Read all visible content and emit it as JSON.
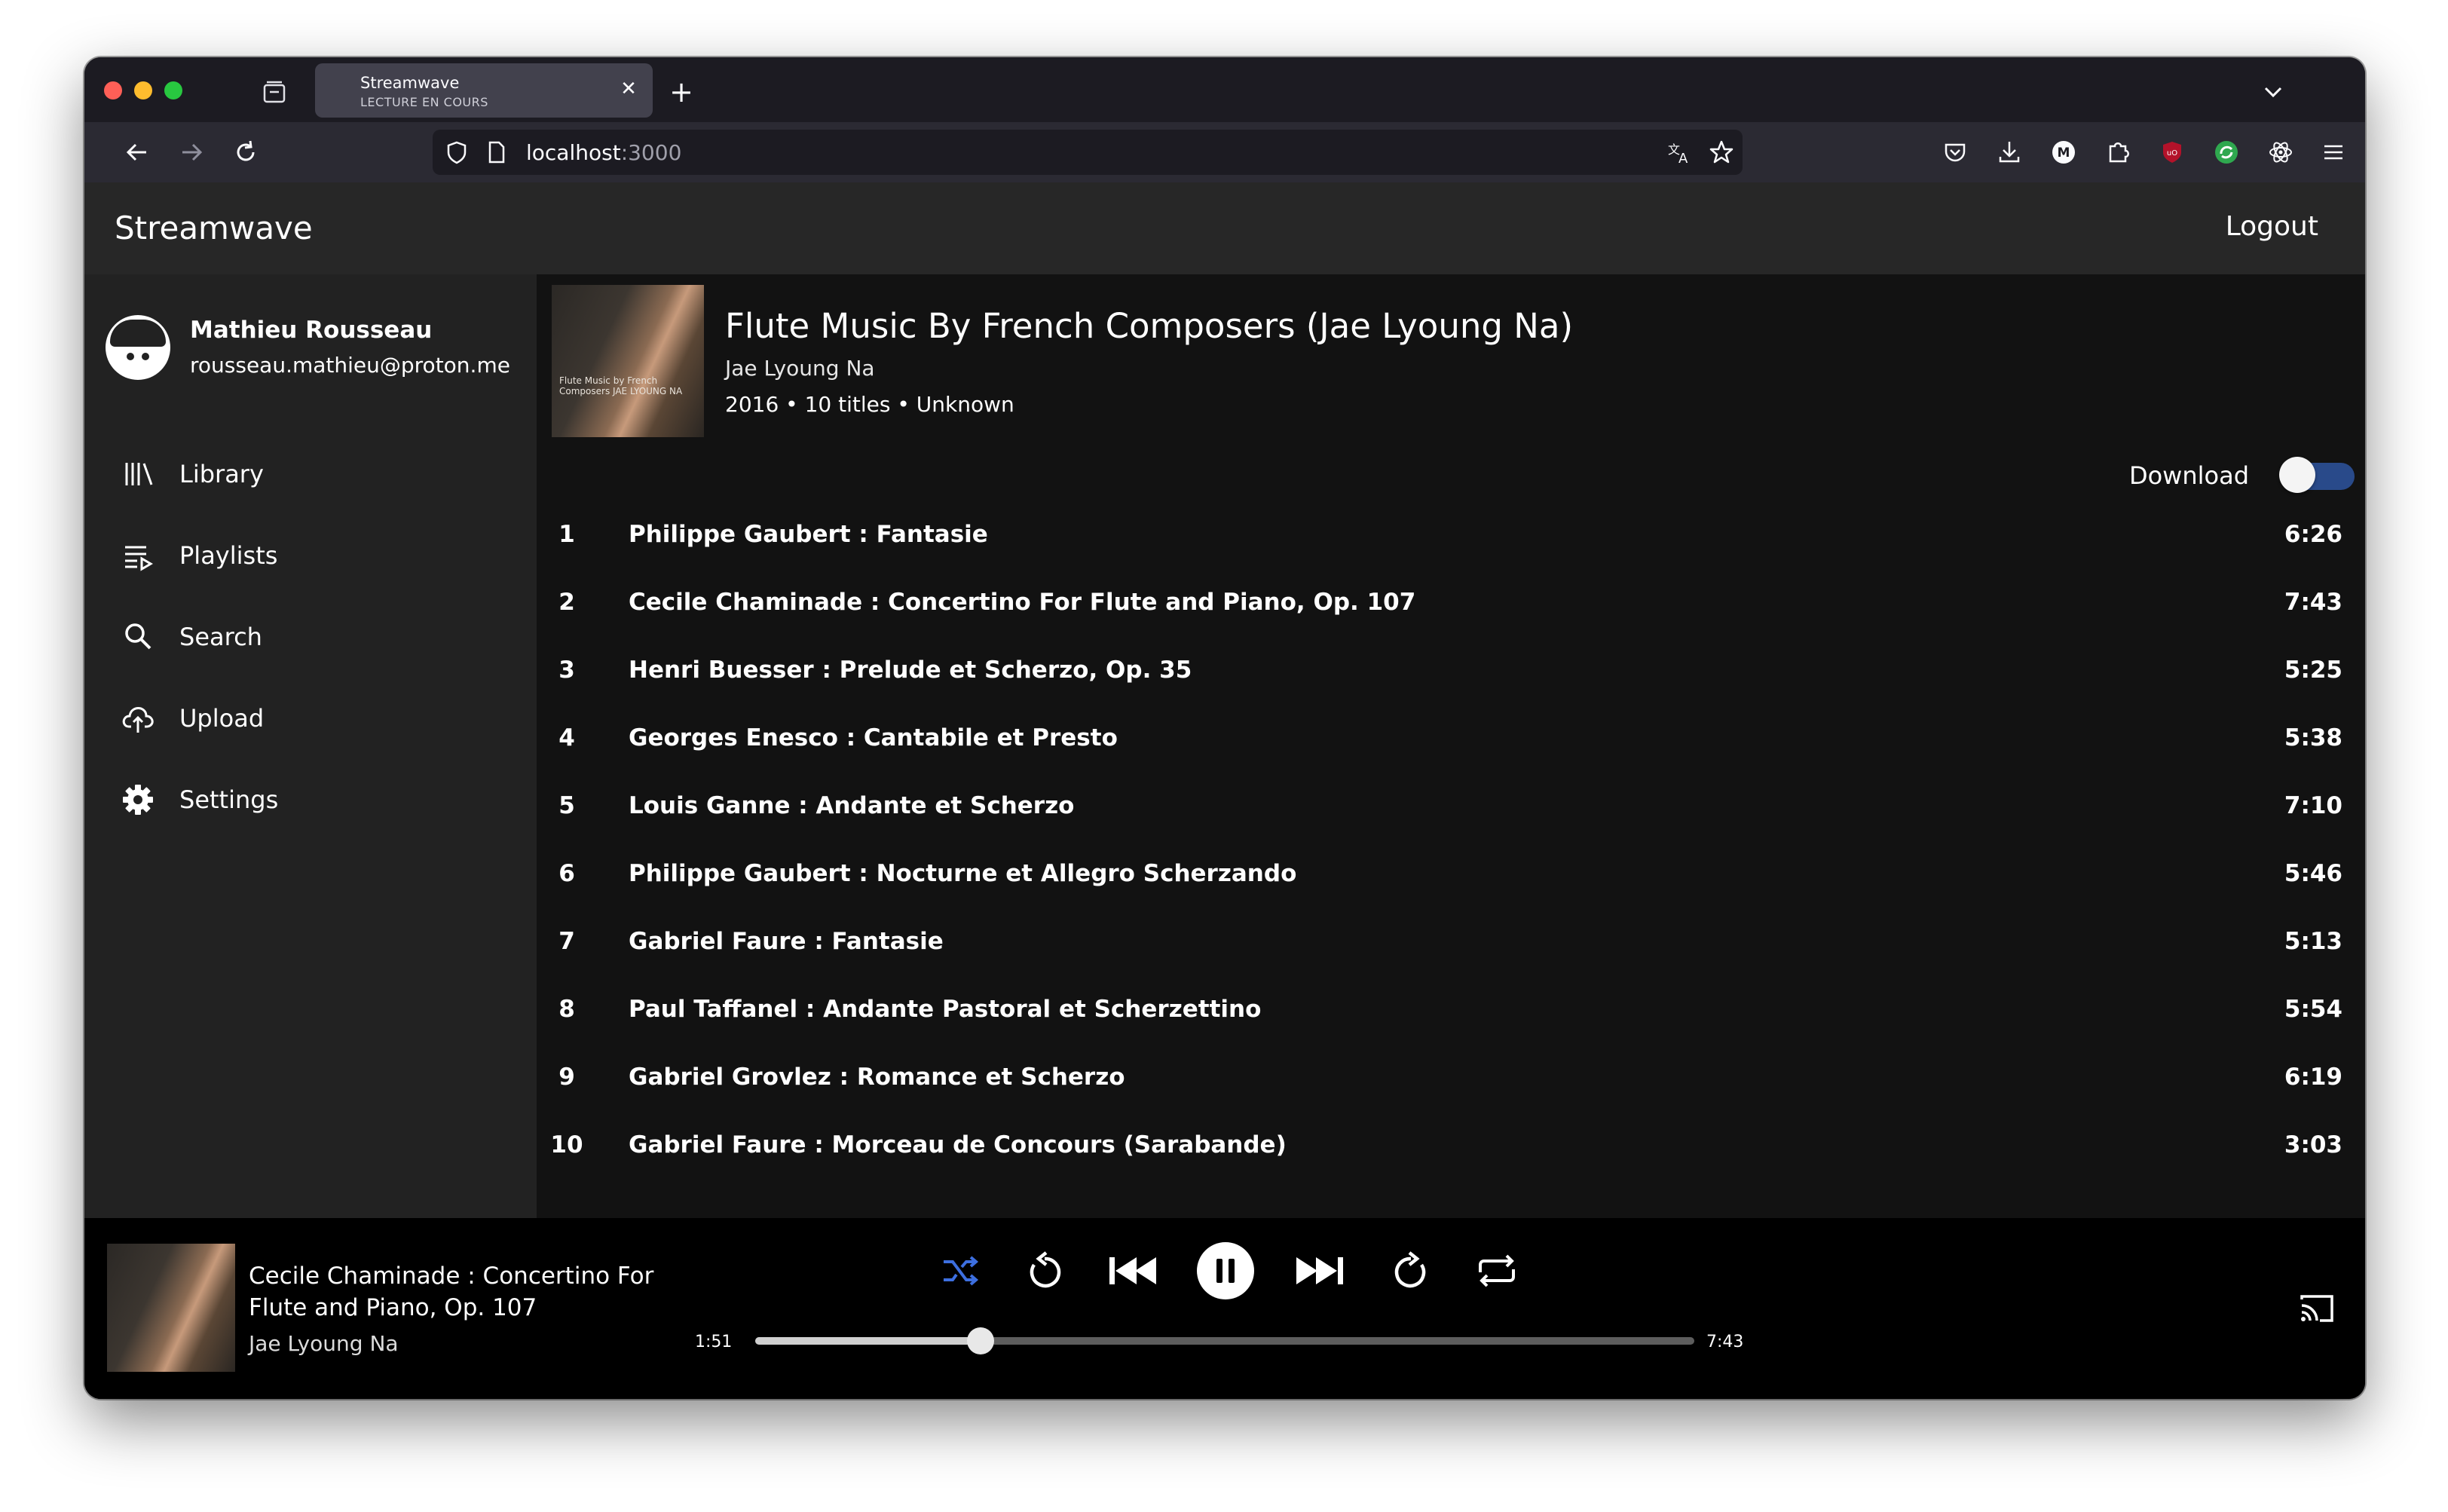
{
  "browser": {
    "tab": {
      "title": "Streamwave",
      "subtitle": "LECTURE EN COURS",
      "close": "✕"
    },
    "new_tab": "+",
    "url": {
      "host": "localhost",
      "port": ":3000"
    }
  },
  "app": {
    "brand": "Streamwave",
    "logout": "Logout"
  },
  "user": {
    "name": "Mathieu Rousseau",
    "email": "rousseau.mathieu@proton.me"
  },
  "sidebar": {
    "items": [
      {
        "label": "Library",
        "icon": "library-icon"
      },
      {
        "label": "Playlists",
        "icon": "playlist-icon"
      },
      {
        "label": "Search",
        "icon": "search-icon"
      },
      {
        "label": "Upload",
        "icon": "upload-icon"
      },
      {
        "label": "Settings",
        "icon": "gear-icon"
      }
    ]
  },
  "album": {
    "title": "Flute Music By French Composers (Jae Lyoung Na)",
    "artist": "Jae Lyoung Na",
    "meta": "2016 • 10 titles • Unknown",
    "cover_text": "Flute Music by French Composers JAE LYOUNG NA",
    "download_label": "Download",
    "download_enabled": false
  },
  "tracks": [
    {
      "num": "1",
      "title": "Philippe Gaubert : Fantasie",
      "duration": "6:26"
    },
    {
      "num": "2",
      "title": "Cecile Chaminade : Concertino For Flute and Piano, Op. 107",
      "duration": "7:43"
    },
    {
      "num": "3",
      "title": "Henri Buesser : Prelude et Scherzo, Op. 35",
      "duration": "5:25"
    },
    {
      "num": "4",
      "title": "Georges Enesco : Cantabile et Presto",
      "duration": "5:38"
    },
    {
      "num": "5",
      "title": "Louis Ganne : Andante et Scherzo",
      "duration": "7:10"
    },
    {
      "num": "6",
      "title": "Philippe Gaubert : Nocturne et Allegro Scherzando",
      "duration": "5:46"
    },
    {
      "num": "7",
      "title": "Gabriel Faure : Fantasie",
      "duration": "5:13"
    },
    {
      "num": "8",
      "title": "Paul Taffanel : Andante Pastoral et Scherzettino",
      "duration": "5:54"
    },
    {
      "num": "9",
      "title": "Gabriel Grovlez : Romance et Scherzo",
      "duration": "6:19"
    },
    {
      "num": "10",
      "title": "Gabriel Faure : Morceau de Concours (Sarabande)",
      "duration": "3:03"
    }
  ],
  "player": {
    "title": "Cecile Chaminade : Concertino For Flute and Piano, Op. 107",
    "artist": "Jae Lyoung Na",
    "elapsed": "1:51",
    "total": "7:43",
    "progress": 0.24,
    "shuffle_active": true,
    "accent": "#3d6fe0"
  },
  "colors": {
    "sidebar_bg": "#222222",
    "header_bg": "#272727",
    "content_bg": "#121212",
    "player_bg": "#000000"
  }
}
